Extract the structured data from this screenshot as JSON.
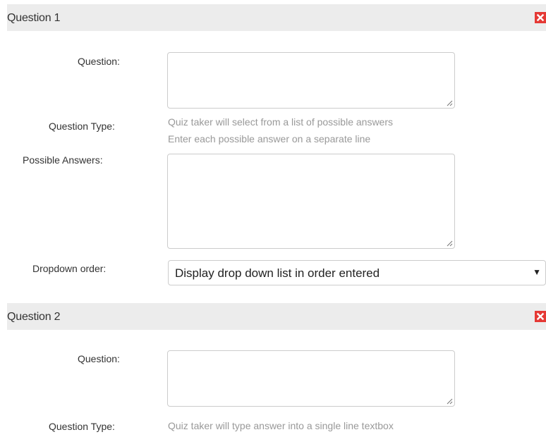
{
  "questions": [
    {
      "title": "Question 1",
      "question_label": "Question:",
      "question_value": "",
      "type_label": "Question Type:",
      "type_help": "Quiz taker will select from a list of possible answers",
      "answers_help": "Enter each possible answer on a separate line",
      "answers_label": "Possible Answers:",
      "answers_value": "",
      "dropdown_label": "Dropdown order:",
      "dropdown_value": "Display drop down list in order entered"
    },
    {
      "title": "Question 2",
      "question_label": "Question:",
      "question_value": "",
      "type_label": "Question Type:",
      "type_help": "Quiz taker will type answer into a single line textbox"
    }
  ],
  "icons": {
    "close": "close-icon",
    "dropdown": "caret-down-icon",
    "resize": "resize-grip-icon"
  },
  "colors": {
    "header_bg": "#ececec",
    "close_bg": "#e53935",
    "help_text": "#999999"
  }
}
